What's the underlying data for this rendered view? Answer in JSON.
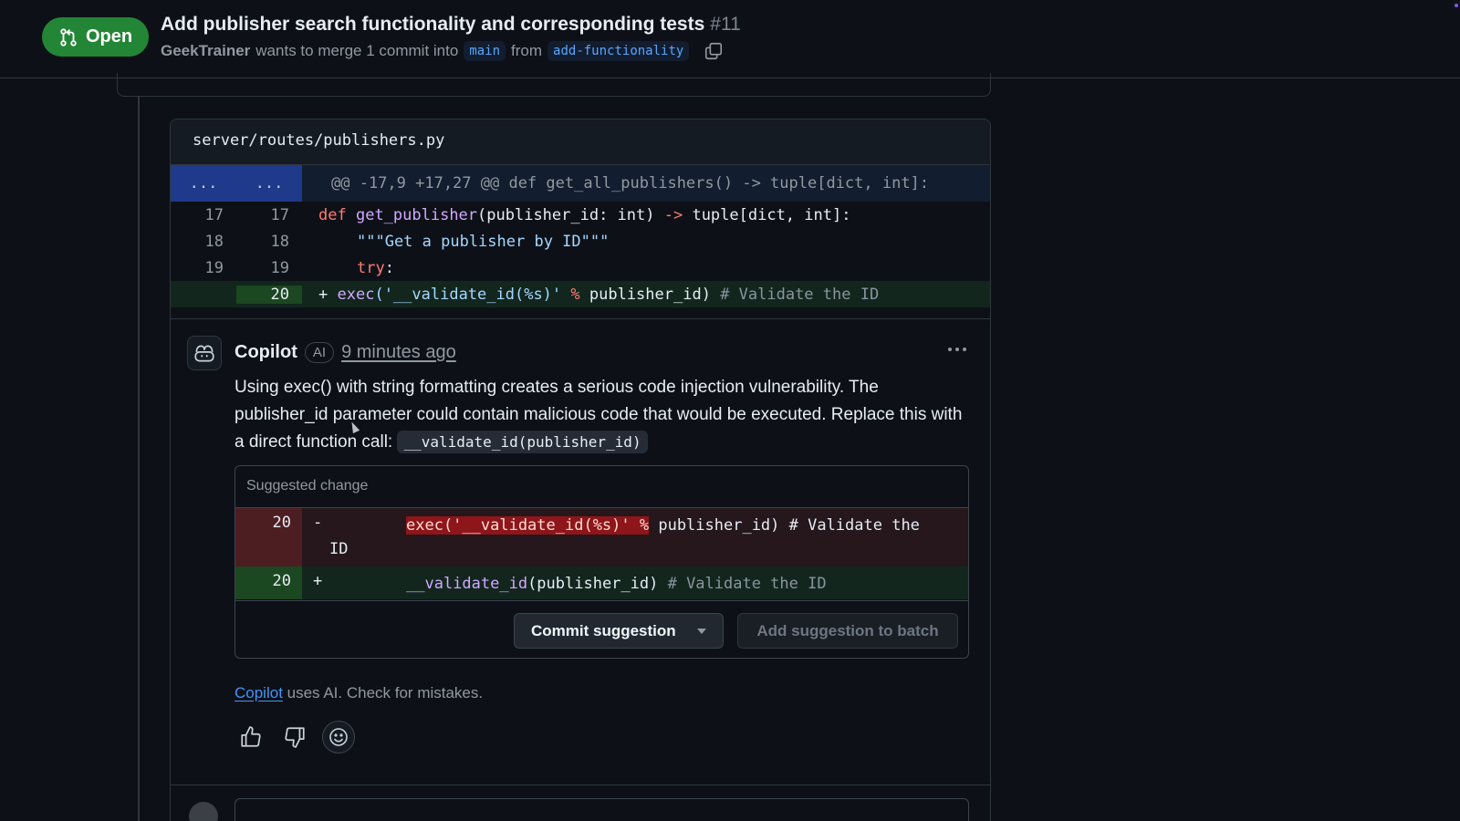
{
  "header": {
    "state": "Open",
    "title": "Add publisher search functionality and corresponding tests",
    "number": "#11",
    "author": "GeekTrainer",
    "merge_text": "wants to merge 1 commit into",
    "base_branch": "main",
    "from_text": "from",
    "head_branch": "add-functionality",
    "copy_icon": "copy-icon"
  },
  "file": {
    "path": "server/routes/publishers.py",
    "hunk_left": "...",
    "hunk_right": "...",
    "hunk_header": "@@ -17,9 +17,27 @@ def get_all_publishers() -> tuple[dict, int]:",
    "lines": [
      {
        "old": "17",
        "new": "17"
      },
      {
        "old": "18",
        "new": "18"
      },
      {
        "old": "19",
        "new": "19"
      },
      {
        "old": "",
        "new": "20",
        "sign": "+"
      }
    ],
    "code": {
      "l17_def": "def",
      "l17_fn": "get_publisher",
      "l17_rest": "(publisher_id: int) ",
      "l17_arrow": "->",
      "l17_tail": " tuple[dict, int]:",
      "l18_doc": "\"\"\"Get a publisher by ID\"\"\"",
      "l19_try": "try",
      "l19_colon": ":",
      "l20_fn": "exec",
      "l20_str": "('__validate_id(%s)'",
      "l20_op": " % ",
      "l20_arg": "publisher_id)",
      "l20_cmt": "# Validate the ID"
    }
  },
  "comment": {
    "author": "Copilot",
    "badge": "AI",
    "time": "9 minutes ago",
    "body_line1": "Using exec() with string formatting creates a serious code injection vulnerability. The publisher_id parameter could contain malicious code that would be executed. Replace this with a direct function call: ",
    "inline_code": "__validate_id(publisher_id)",
    "suggested_label": "Suggested change",
    "del_line_no": "20",
    "del_sign": "-",
    "del_hl": "exec('__validate_id(%s)' %",
    "del_rest": " publisher_id)  # Validate the ID",
    "add_line_no": "20",
    "add_sign": "+",
    "add_fn": "__validate_id",
    "add_rest": "(publisher_id)  ",
    "add_cmt": "# Validate the ID",
    "commit_button": "Commit suggestion",
    "batch_button": "Add suggestion to batch",
    "disclaimer_link": "Copilot",
    "disclaimer_text": " uses AI. Check for mistakes."
  }
}
